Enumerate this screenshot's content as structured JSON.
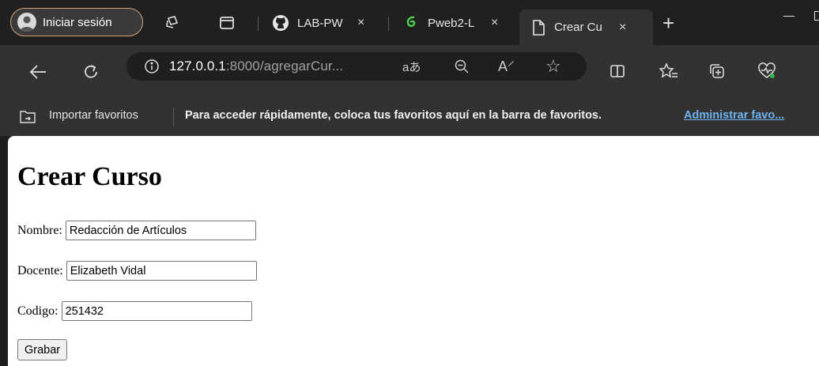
{
  "browser": {
    "profile_label": "Iniciar sesión",
    "tabs": [
      {
        "title": "LAB-PW",
        "icon": "github-icon"
      },
      {
        "title": "Pweb2-L",
        "icon": "gitlab-icon"
      },
      {
        "title": "Crear Cu",
        "icon": "page-icon",
        "active": true
      }
    ],
    "tab_close_glyph": "×",
    "new_tab_glyph": "+",
    "address": {
      "host": "127.0.0.1",
      "path": ":8000/agregarCur..."
    },
    "favorites": {
      "import_label": "Importar favoritos",
      "message": "Para acceder rápidamente, coloca tus favoritos aquí en la barra de favoritos.",
      "manage_link": "Administrar favo..."
    },
    "accent_color": "#d3a574",
    "link_color": "#6fb3f2"
  },
  "page": {
    "heading": "Crear Curso",
    "fields": {
      "nombre": {
        "label": "Nombre:",
        "value": "Redacción de Artículos"
      },
      "docente": {
        "label": "Docente:",
        "value": "Elizabeth Vidal"
      },
      "codigo": {
        "label": "Codigo:",
        "value": "251432"
      }
    },
    "submit_label": "Grabar"
  }
}
